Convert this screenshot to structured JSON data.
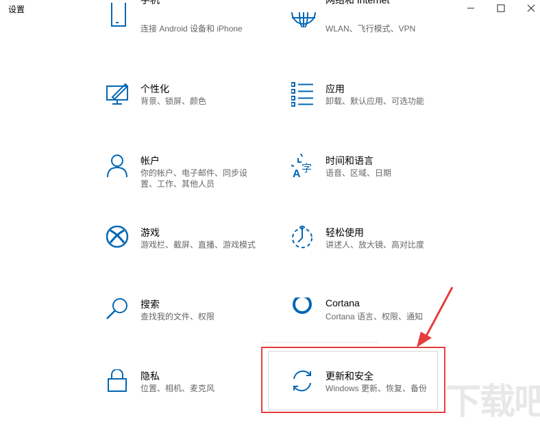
{
  "window": {
    "title": "设置",
    "controls": [
      "minimize-icon",
      "maximize-icon",
      "close-icon"
    ]
  },
  "accent_color": "#0066b4",
  "highlight_color": "#e53c3c",
  "tiles": [
    {
      "key": "phone",
      "name": "手机",
      "desc": "连接 Android 设备和 iPhone",
      "icon": "phone-icon"
    },
    {
      "key": "network",
      "name": "网络和 Internet",
      "desc": "WLAN、飞行模式、VPN",
      "icon": "globe-icon"
    },
    {
      "key": "personalization",
      "name": "个性化",
      "desc": "背景、锁屏、颜色",
      "icon": "personalization-icon"
    },
    {
      "key": "apps",
      "name": "应用",
      "desc": "卸载、默认应用、可选功能",
      "icon": "apps-list-icon"
    },
    {
      "key": "accounts",
      "name": "帐户",
      "desc": "你的帐户、电子邮件、同步设置、工作、其他人员",
      "icon": "person-icon"
    },
    {
      "key": "time",
      "name": "时间和语言",
      "desc": "语音、区域、日期",
      "icon": "time-language-icon"
    },
    {
      "key": "gaming",
      "name": "游戏",
      "desc": "游戏栏、截屏、直播、游戏模式",
      "icon": "xbox-icon"
    },
    {
      "key": "ease",
      "name": "轻松使用",
      "desc": "讲述人、放大镜、高对比度",
      "icon": "ease-of-access-icon"
    },
    {
      "key": "search",
      "name": "搜索",
      "desc": "查找我的文件、权限",
      "icon": "search-icon"
    },
    {
      "key": "cortana",
      "name": "Cortana",
      "desc": "Cortana 语言、权限、通知",
      "icon": "cortana-icon"
    },
    {
      "key": "privacy",
      "name": "隐私",
      "desc": "位置、相机、麦克风",
      "icon": "lock-icon"
    },
    {
      "key": "update",
      "name": "更新和安全",
      "desc": "Windows 更新、恢复、备份",
      "icon": "sync-icon"
    }
  ],
  "watermark": "下载吧"
}
